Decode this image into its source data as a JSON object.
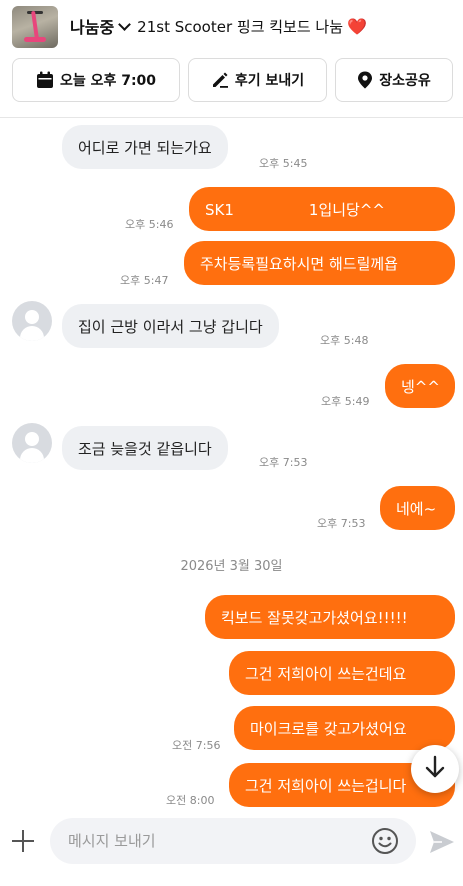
{
  "header": {
    "status": "나눔중",
    "product_title": "21st Scooter 핑크 킥보드 나눔",
    "heart": "❤️",
    "buttons": {
      "schedule": "오늘 오후 7:00",
      "review": "후기 보내기",
      "location": "장소공유"
    }
  },
  "messages": [
    {
      "side": "received",
      "avatar": false,
      "text": "어디로 가면 되는가요",
      "time": "오후 5:45"
    },
    {
      "side": "sent",
      "text": "SK1          1입니당^^",
      "time": "오후 5:46"
    },
    {
      "side": "sent",
      "text": "주차등록필요하시면 해드릴께욥",
      "time": "오후 5:47"
    },
    {
      "side": "received",
      "avatar": true,
      "text": "집이 근방 이라서 그냥 갑니다",
      "time": "오후 5:48"
    },
    {
      "side": "sent",
      "text": "넹^^",
      "time": "오후 5:49"
    },
    {
      "side": "received",
      "avatar": true,
      "text": "조금 늦을것 같읍니다",
      "time": "오후 7:53"
    },
    {
      "side": "sent",
      "text": "네에~",
      "time": "오후 7:53"
    },
    {
      "side": "sent",
      "text": "킥보드 잘못갖고가셨어요!!!!!",
      "time": ""
    },
    {
      "side": "sent",
      "text": "그건 저희아이 쓰는건데요",
      "time": ""
    },
    {
      "side": "sent",
      "text": "마이크로를 갖고가셨어요",
      "time": "오전 7:56"
    },
    {
      "side": "sent",
      "text": "그건 저희아이 쓰는겁니다",
      "time": "오전 8:00"
    }
  ],
  "date_separator": "2026년 3월 30일",
  "input": {
    "placeholder": "메시지 보내기"
  },
  "colors": {
    "accent": "#ff6f0f",
    "received_bubble": "#eef0f3"
  },
  "icons": [
    "calendar-icon",
    "pencil-icon",
    "location-pin-icon",
    "plus-icon",
    "emoji-icon",
    "send-icon",
    "arrow-down-icon",
    "avatar-icon"
  ]
}
